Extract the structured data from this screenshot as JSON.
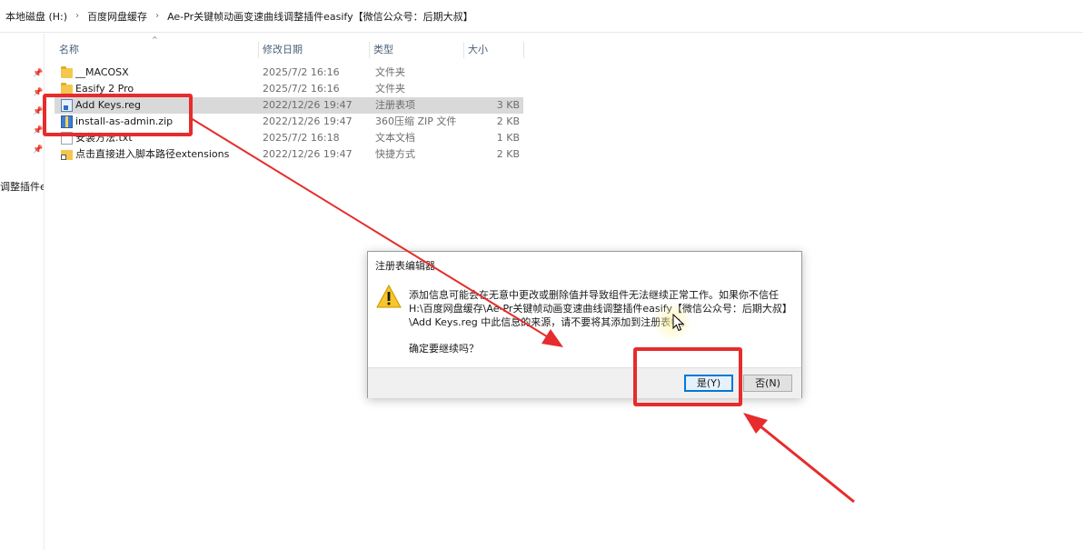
{
  "breadcrumb": [
    "本地磁盘 (H:)",
    "百度网盘缓存",
    "Ae-Pr关键帧动画变速曲线调整插件easify【微信公众号：后期大叔】"
  ],
  "nav": {
    "clipped_label": "调整插件eas"
  },
  "columns": {
    "name": "名称",
    "date": "修改日期",
    "type": "类型",
    "size": "大小"
  },
  "files": [
    {
      "name": "__MACOSX",
      "date": "2025/7/2 16:16",
      "type": "文件夹",
      "size": "",
      "icon": "folder-icon"
    },
    {
      "name": "Easify 2 Pro",
      "date": "2025/7/2 16:16",
      "type": "文件夹",
      "size": "",
      "icon": "folder-icon"
    },
    {
      "name": "Add Keys.reg",
      "date": "2022/12/26 19:47",
      "type": "注册表项",
      "size": "3 KB",
      "icon": "reg-file-icon"
    },
    {
      "name": "install-as-admin.zip",
      "date": "2022/12/26 19:47",
      "type": "360压缩 ZIP 文件",
      "size": "2 KB",
      "icon": "zip-file-icon"
    },
    {
      "name": "安装方法.txt",
      "date": "2025/7/2 16:18",
      "type": "文本文档",
      "size": "1 KB",
      "icon": "text-file-icon"
    },
    {
      "name": "点击直接进入脚本路径extensions",
      "date": "2022/12/26 19:47",
      "type": "快捷方式",
      "size": "2 KB",
      "icon": "shortcut-icon"
    }
  ],
  "dialog": {
    "title": "注册表编辑器",
    "message": "添加信息可能会在无意中更改或删除值并导致组件无法继续正常工作。如果你不信任 H:\\百度网盘缓存\\Ae-Pr关键帧动画变速曲线调整插件easify【微信公众号：后期大叔】\\Add Keys.reg 中此信息的来源，请不要将其添加到注册表中。",
    "confirm": "确定要继续吗？",
    "yes_label": "是(Y)",
    "no_label": "否(N)"
  },
  "colors": {
    "annotation": "#e62c2c",
    "selected_row": "#d9d9d9",
    "default_button_border": "#0078d7"
  }
}
